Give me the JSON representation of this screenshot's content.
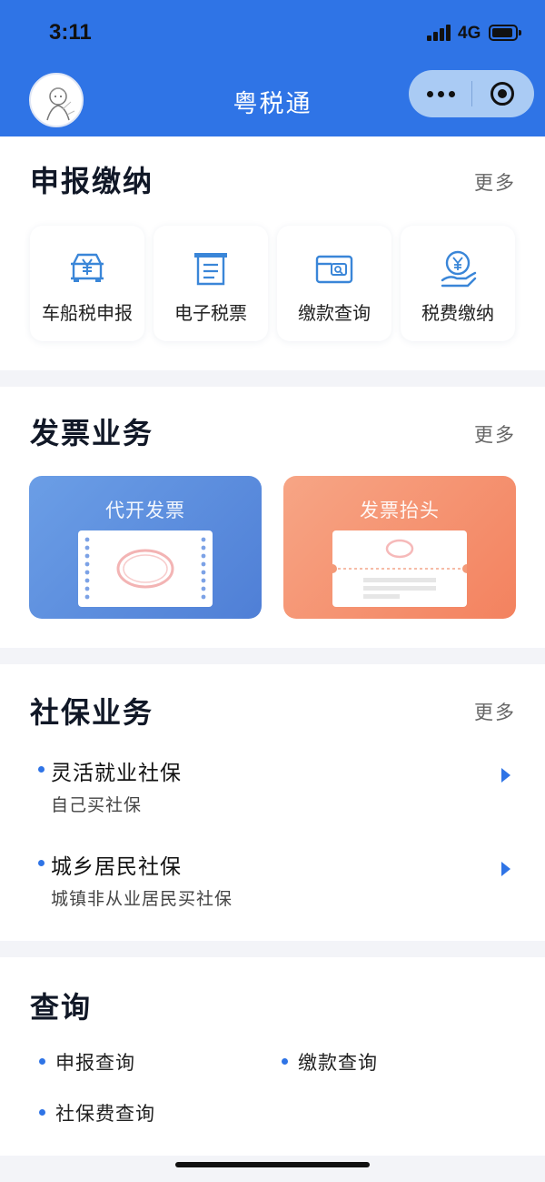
{
  "status_bar": {
    "time": "3:11",
    "network": "4G"
  },
  "header": {
    "title": "粤税通"
  },
  "colors": {
    "brand": "#2f74e6",
    "invoice_left": "#5b8fe0",
    "invoice_right": "#f7906a"
  },
  "sections": {
    "declare": {
      "title": "申报缴纳",
      "more": "更多",
      "items": [
        {
          "label": "车船税申报",
          "icon": "car-yuan-icon"
        },
        {
          "label": "电子税票",
          "icon": "receipt-icon"
        },
        {
          "label": "缴款查询",
          "icon": "wallet-search-icon"
        },
        {
          "label": "税费缴纳",
          "icon": "hand-coin-icon"
        }
      ]
    },
    "invoice": {
      "title": "发票业务",
      "more": "更多",
      "items": [
        {
          "label": "代开发票",
          "icon": "invoice-ticket-icon"
        },
        {
          "label": "发票抬头",
          "icon": "invoice-header-icon"
        }
      ]
    },
    "social": {
      "title": "社保业务",
      "more": "更多",
      "items": [
        {
          "title": "灵活就业社保",
          "subtitle": "自己买社保"
        },
        {
          "title": "城乡居民社保",
          "subtitle": "城镇非从业居民买社保"
        }
      ]
    },
    "query": {
      "title": "查询",
      "items": [
        {
          "label": "申报查询"
        },
        {
          "label": "缴款查询"
        },
        {
          "label": "社保费查询"
        }
      ]
    }
  }
}
